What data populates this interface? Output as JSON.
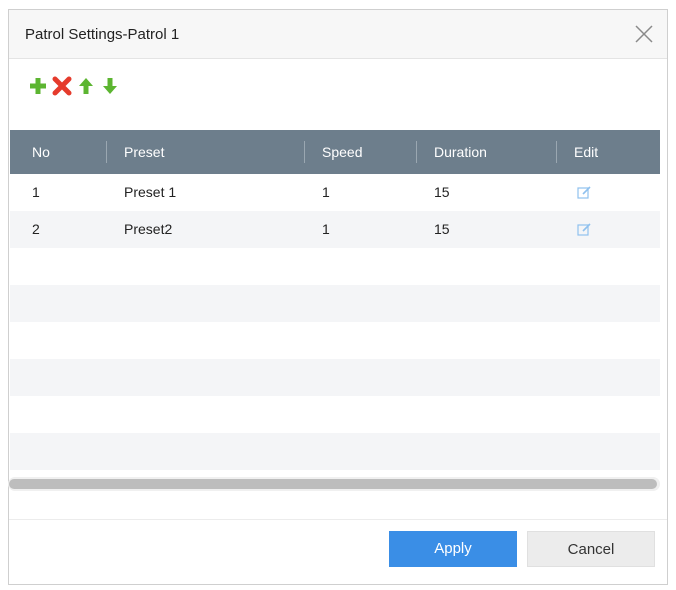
{
  "dialog": {
    "title": "Patrol Settings-Patrol 1",
    "close_icon": "close-icon"
  },
  "toolbar": {
    "icons": [
      "add-icon",
      "delete-icon",
      "move-up-icon",
      "move-down-icon"
    ],
    "colors": {
      "add": "#5cb531",
      "delete": "#e53b2c",
      "up": "#5cb531",
      "down": "#5cb531"
    }
  },
  "table": {
    "headers": [
      "No",
      "Preset",
      "Speed",
      "Duration",
      "Edit"
    ],
    "header_bg": "#6d7e8c",
    "rows": [
      {
        "no": "1",
        "preset": "Preset 1",
        "speed": "1",
        "duration": "15",
        "edit_icon": "edit-icon"
      },
      {
        "no": "2",
        "preset": "Preset2",
        "speed": "1",
        "duration": "15",
        "edit_icon": "edit-icon"
      }
    ],
    "empty_rows": 6
  },
  "buttons": {
    "apply": "Apply",
    "cancel": "Cancel",
    "apply_color": "#3a8ee6"
  }
}
